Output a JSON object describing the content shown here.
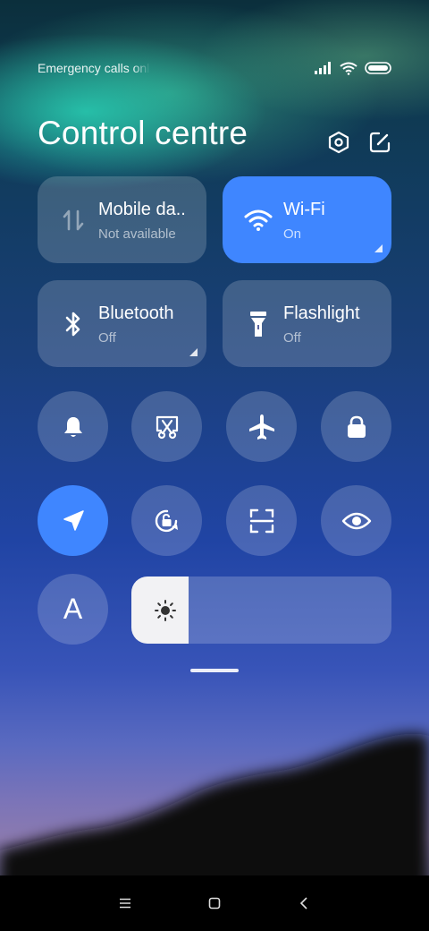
{
  "status_bar": {
    "text": "Emergency calls only",
    "icons": [
      "signal-icon",
      "wifi-icon",
      "battery-icon"
    ]
  },
  "header": {
    "title": "Control centre",
    "icons": [
      "settings-icon",
      "edit-icon"
    ]
  },
  "tiles": [
    {
      "name": "Mobile da..",
      "status": "Not available",
      "icon": "mobile-data-icon",
      "active": false
    },
    {
      "name": "Wi-Fi",
      "status": "On",
      "icon": "wifi-icon",
      "active": true
    },
    {
      "name": "Bluetooth",
      "status": "Off",
      "icon": "bluetooth-icon",
      "active": false
    },
    {
      "name": "Flashlight",
      "status": "Off",
      "icon": "flashlight-icon",
      "active": false
    }
  ],
  "toggles": [
    {
      "icon": "bell-icon",
      "active": false
    },
    {
      "icon": "screenshot-icon",
      "active": false
    },
    {
      "icon": "airplane-icon",
      "active": false
    },
    {
      "icon": "lock-icon",
      "active": false
    },
    {
      "icon": "location-icon",
      "active": true
    },
    {
      "icon": "auto-rotate-icon",
      "active": false
    },
    {
      "icon": "scanner-icon",
      "active": false
    },
    {
      "icon": "eye-icon",
      "active": false
    }
  ],
  "font_button": {
    "label": "A"
  },
  "brightness": {
    "icon": "sun-icon",
    "level": 0.22
  },
  "colors": {
    "accent": "#3f86ff",
    "tile_bg": "rgba(255,255,255,0.18)"
  },
  "nav_bar": {
    "buttons": [
      "menu-icon",
      "home-icon",
      "back-icon"
    ]
  }
}
